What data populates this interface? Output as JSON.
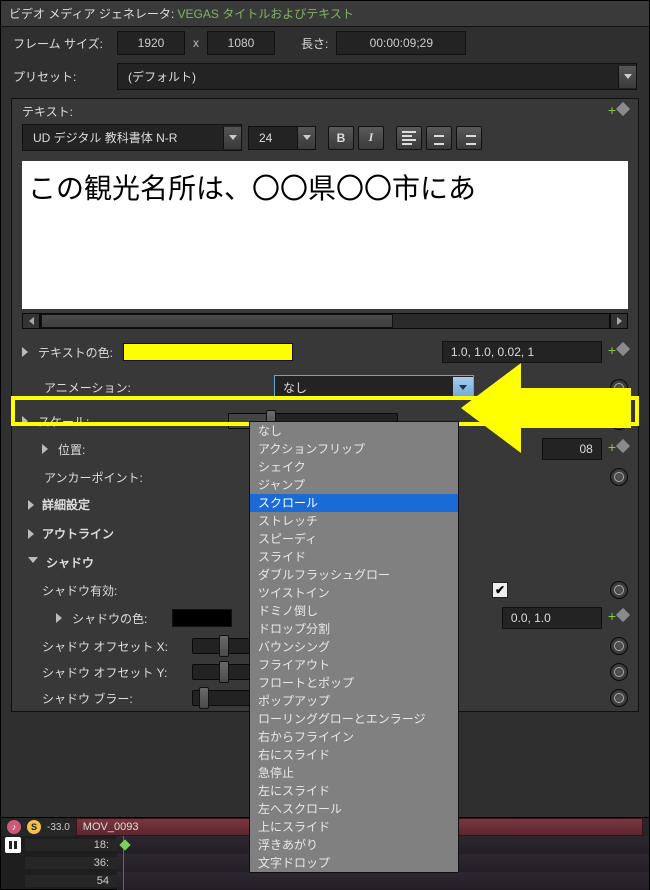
{
  "titlebar": {
    "prefix": "ビデオ メディア ジェネレータ:",
    "name": " VEGAS タイトルおよびテキスト"
  },
  "frame": {
    "label": "フレーム サイズ:",
    "w": "1920",
    "x": "x",
    "h": "1080",
    "len_label": "長さ:",
    "len": "00:00:09;29"
  },
  "preset": {
    "label": "プリセット:",
    "value": "(デフォルト)"
  },
  "text": {
    "label": "テキスト:",
    "font": "UD デジタル 教科書体 N-R",
    "size": "24",
    "b": "B",
    "i": "I",
    "content": "この観光名所は、〇〇県〇〇市にあ"
  },
  "color": {
    "label": "テキストの色:",
    "hex": "#ffff00",
    "rgba": "1.0, 1.0, 0.02, 1"
  },
  "anim": {
    "label": "アニメーション:",
    "value": "なし",
    "options": [
      "なし",
      "アクションフリップ",
      "シェイク",
      "ジャンプ",
      "スクロール",
      "ストレッチ",
      "スピーディ",
      "スライド",
      "ダブルフラッシュグロー",
      "ツイストイン",
      "ドミノ倒し",
      "ドロップ分割",
      "バウンシング",
      "フライアウト",
      "フロートとポップ",
      "ポップアップ",
      "ローリンググローとエンラージ",
      "右からフライイン",
      "右にスライド",
      "急停止",
      "左にスライド",
      "左へスクロール",
      "上にスライド",
      "浮きあがり",
      "文字ドロップ"
    ],
    "selected_index": 4
  },
  "scale": {
    "label": "スケール:"
  },
  "position": {
    "label": "位置:",
    "val_right": "08"
  },
  "anchor": {
    "label": "アンカーポイント:"
  },
  "adv": {
    "label": "詳細設定"
  },
  "outline": {
    "label": "アウトライン"
  },
  "shadow": {
    "label": "シャドウ",
    "enable_label": "シャドウ有効:",
    "color_label": "シャドウの色:",
    "color_hex": "#000000",
    "color_rgba": "0.0, 1.0",
    "offx": "シャドウ オフセット X:",
    "offy": "シャドウ オフセット Y:",
    "blur": "シャドウ ブラー:"
  },
  "timeline": {
    "db": "-33.0",
    "clip": "MOV_0093",
    "rows": [
      "18:",
      "36:",
      "54"
    ]
  }
}
